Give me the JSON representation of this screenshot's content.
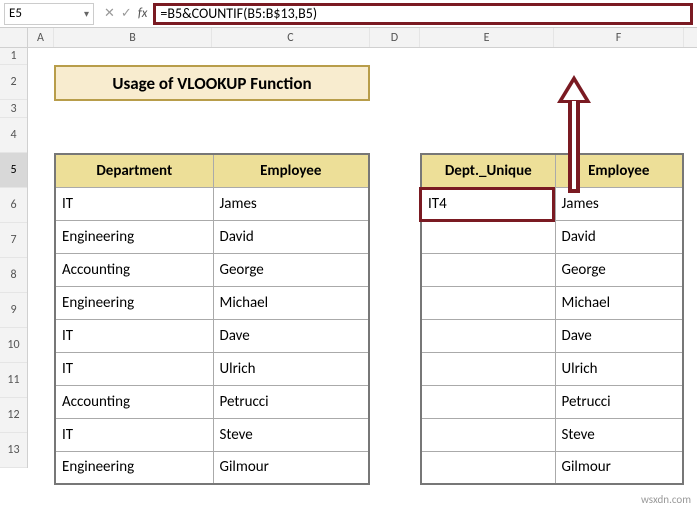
{
  "formula_bar": {
    "cell_ref": "E5",
    "cancel_icon": "✕",
    "enter_icon": "✓",
    "fx_label": "fx",
    "formula": "=B5&COUNTIF(B5:B$13,B5)"
  },
  "columns": {
    "A": "A",
    "B": "B",
    "C": "C",
    "D": "D",
    "E": "E",
    "F": "F"
  },
  "rows": [
    "1",
    "2",
    "3",
    "4",
    "5",
    "6",
    "7",
    "8",
    "9",
    "10",
    "11",
    "12",
    "13"
  ],
  "active_row": "5",
  "title": "Usage of VLOOKUP Function",
  "table1": {
    "headers": [
      "Department",
      "Employee"
    ],
    "rows": [
      [
        "IT",
        "James"
      ],
      [
        "Engineering",
        "David"
      ],
      [
        "Accounting",
        "George"
      ],
      [
        "Engineering",
        "Michael"
      ],
      [
        "IT",
        "Dave"
      ],
      [
        "IT",
        "Ulrich"
      ],
      [
        "Accounting",
        "Petrucci"
      ],
      [
        "IT",
        "Steve"
      ],
      [
        "Engineering",
        "Gilmour"
      ]
    ]
  },
  "table2": {
    "headers": [
      "Dept._Unique",
      "Employee"
    ],
    "rows": [
      [
        "IT4",
        "James"
      ],
      [
        "",
        "David"
      ],
      [
        "",
        "George"
      ],
      [
        "",
        "Michael"
      ],
      [
        "",
        "Dave"
      ],
      [
        "",
        "Ulrich"
      ],
      [
        "",
        "Petrucci"
      ],
      [
        "",
        "Steve"
      ],
      [
        "",
        "Gilmour"
      ]
    ]
  },
  "watermark": "wsxdn.com"
}
